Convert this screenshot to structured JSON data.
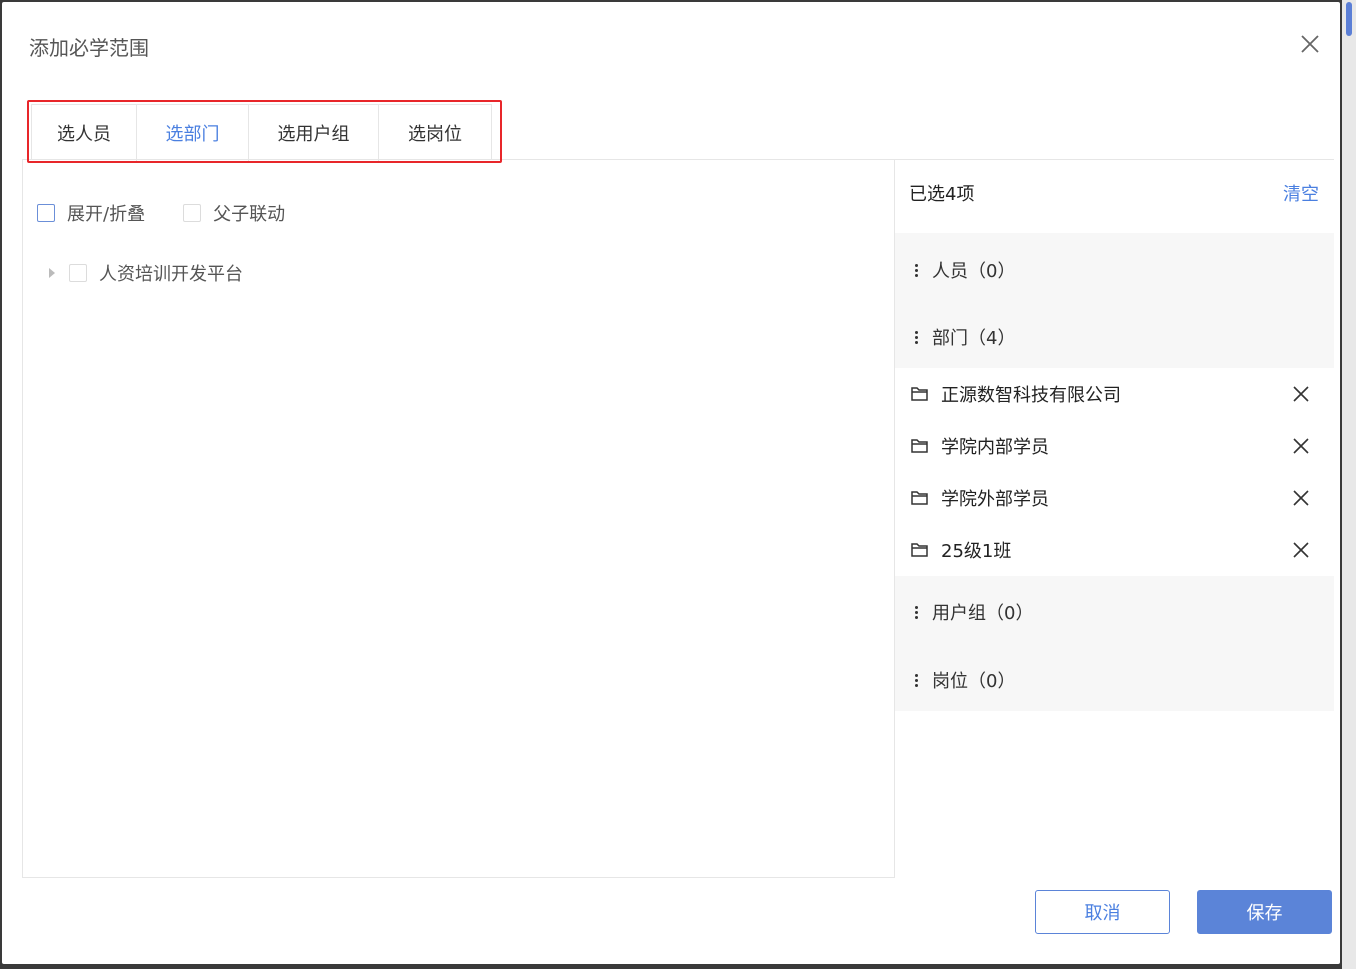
{
  "dialog": {
    "title": "添加必学范围"
  },
  "tabs": [
    {
      "label": "选人员"
    },
    {
      "label": "选部门",
      "active": true
    },
    {
      "label": "选用户组"
    },
    {
      "label": "选岗位"
    }
  ],
  "left": {
    "expand_collapse_label": "展开/折叠",
    "parent_child_label": "父子联动",
    "tree_root": "人资培训开发平台"
  },
  "right": {
    "selected_count_label": "已选4项",
    "clear_label": "清空",
    "groups": {
      "people": "人员（0）",
      "departments": "部门（4）",
      "user_groups": "用户组（0）",
      "positions": "岗位（0）"
    },
    "selected_departments": [
      "正源数智科技有限公司",
      "学院内部学员",
      "学院外部学员",
      "25级1班"
    ]
  },
  "buttons": {
    "cancel": "取消",
    "save": "保存"
  },
  "colors": {
    "accent": "#4a7fe0",
    "highlight_border": "#e8262a"
  }
}
